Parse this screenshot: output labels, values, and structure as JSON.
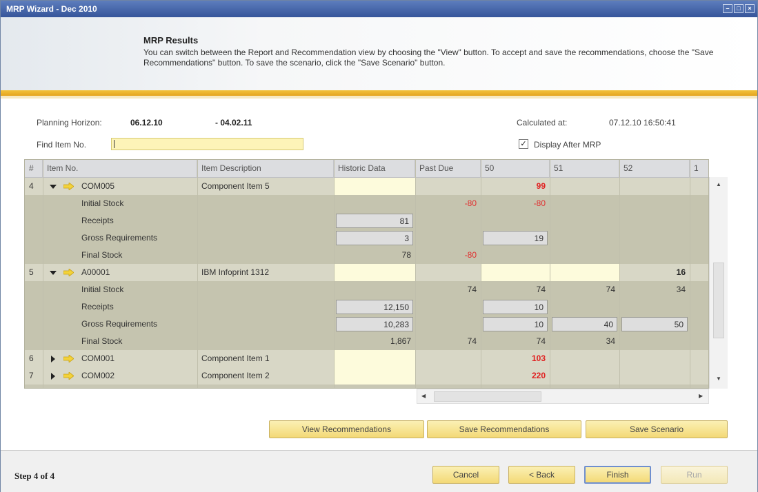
{
  "window": {
    "title": "MRP Wizard - Dec 2010"
  },
  "header": {
    "title": "MRP Results",
    "description": "You can switch between the Report and Recommendation view by choosing the \"View\" button. To accept and save the recommendations, choose the \"Save Recommendations\" button. To save the scenario, click the \"Save Scenario\" button."
  },
  "planning": {
    "horizon_label": "Planning Horizon:",
    "from": "06.12.10",
    "dash_to": "-  04.02.11",
    "calculated_label": "Calculated at:",
    "calculated_value": "07.12.10  16:50:41"
  },
  "find": {
    "label": "Find Item No.",
    "value": ""
  },
  "display_after_mrp": {
    "label": "Display After MRP",
    "checked": true,
    "mark": "✓"
  },
  "grid": {
    "columns": [
      "#",
      "Item No.",
      "Item Description",
      "Historic Data",
      "Past Due",
      "50",
      "51",
      "52",
      "1"
    ],
    "rows": [
      {
        "type": "item",
        "num": "4",
        "expanded": true,
        "item_no": "COM005",
        "desc": "Component Item 5",
        "historic": "",
        "past_due": "",
        "w50": "99",
        "w51": "",
        "w52": "",
        "w1": ""
      },
      {
        "type": "sub",
        "label": "Initial Stock",
        "historic": "",
        "past_due": "-80",
        "w50": "-80",
        "w51": "",
        "w52": "",
        "w1": ""
      },
      {
        "type": "sub",
        "label": "Receipts",
        "historic": "81",
        "past_due": "",
        "w50": "",
        "w51": "",
        "w52": "",
        "w1": ""
      },
      {
        "type": "sub",
        "label": "Gross Requirements",
        "historic": "3",
        "past_due": "",
        "w50": "19",
        "w51": "",
        "w52": "",
        "w1": ""
      },
      {
        "type": "sub",
        "label": "Final Stock",
        "historic": "78",
        "past_due": "-80",
        "w50": "",
        "w51": "",
        "w52": "",
        "w1": ""
      },
      {
        "type": "item",
        "num": "5",
        "expanded": true,
        "item_no": "A00001",
        "desc": "IBM Infoprint 1312",
        "historic": "",
        "past_due": "",
        "w50": "",
        "w51": "",
        "w52": "16",
        "w1": ""
      },
      {
        "type": "sub",
        "label": "Initial Stock",
        "historic": "",
        "past_due": "74",
        "w50": "74",
        "w51": "74",
        "w52": "34",
        "w1": ""
      },
      {
        "type": "sub",
        "label": "Receipts",
        "historic": "12,150",
        "past_due": "",
        "w50": "10",
        "w51": "",
        "w52": "",
        "w1": ""
      },
      {
        "type": "sub",
        "label": "Gross Requirements",
        "historic": "10,283",
        "past_due": "",
        "w50": "10",
        "w51": "40",
        "w52": "50",
        "w1": ""
      },
      {
        "type": "sub",
        "label": "Final Stock",
        "historic": "1,867",
        "past_due": "74",
        "w50": "74",
        "w51": "34",
        "w52": "",
        "w1": ""
      },
      {
        "type": "item",
        "num": "6",
        "expanded": false,
        "item_no": "COM001",
        "desc": "Component Item 1",
        "historic": "",
        "past_due": "",
        "w50": "103",
        "w51": "",
        "w52": "",
        "w1": ""
      },
      {
        "type": "item",
        "num": "7",
        "expanded": false,
        "item_no": "COM002",
        "desc": "Component Item 2",
        "historic": "",
        "past_due": "",
        "w50": "220",
        "w51": "",
        "w52": "",
        "w1": ""
      }
    ]
  },
  "actions": {
    "view_recommendations": "View Recommendations",
    "save_recommendations": "Save Recommendations",
    "save_scenario": "Save Scenario"
  },
  "footer": {
    "step": "Step 4 of 4",
    "cancel": "Cancel",
    "back": "< Back",
    "finish": "Finish",
    "run": "Run"
  },
  "colors": {
    "title_bar": "#36559a",
    "accent_gold": "#f2c13a",
    "negative": "#e03030",
    "input_yellow": "#fdf4b8"
  }
}
